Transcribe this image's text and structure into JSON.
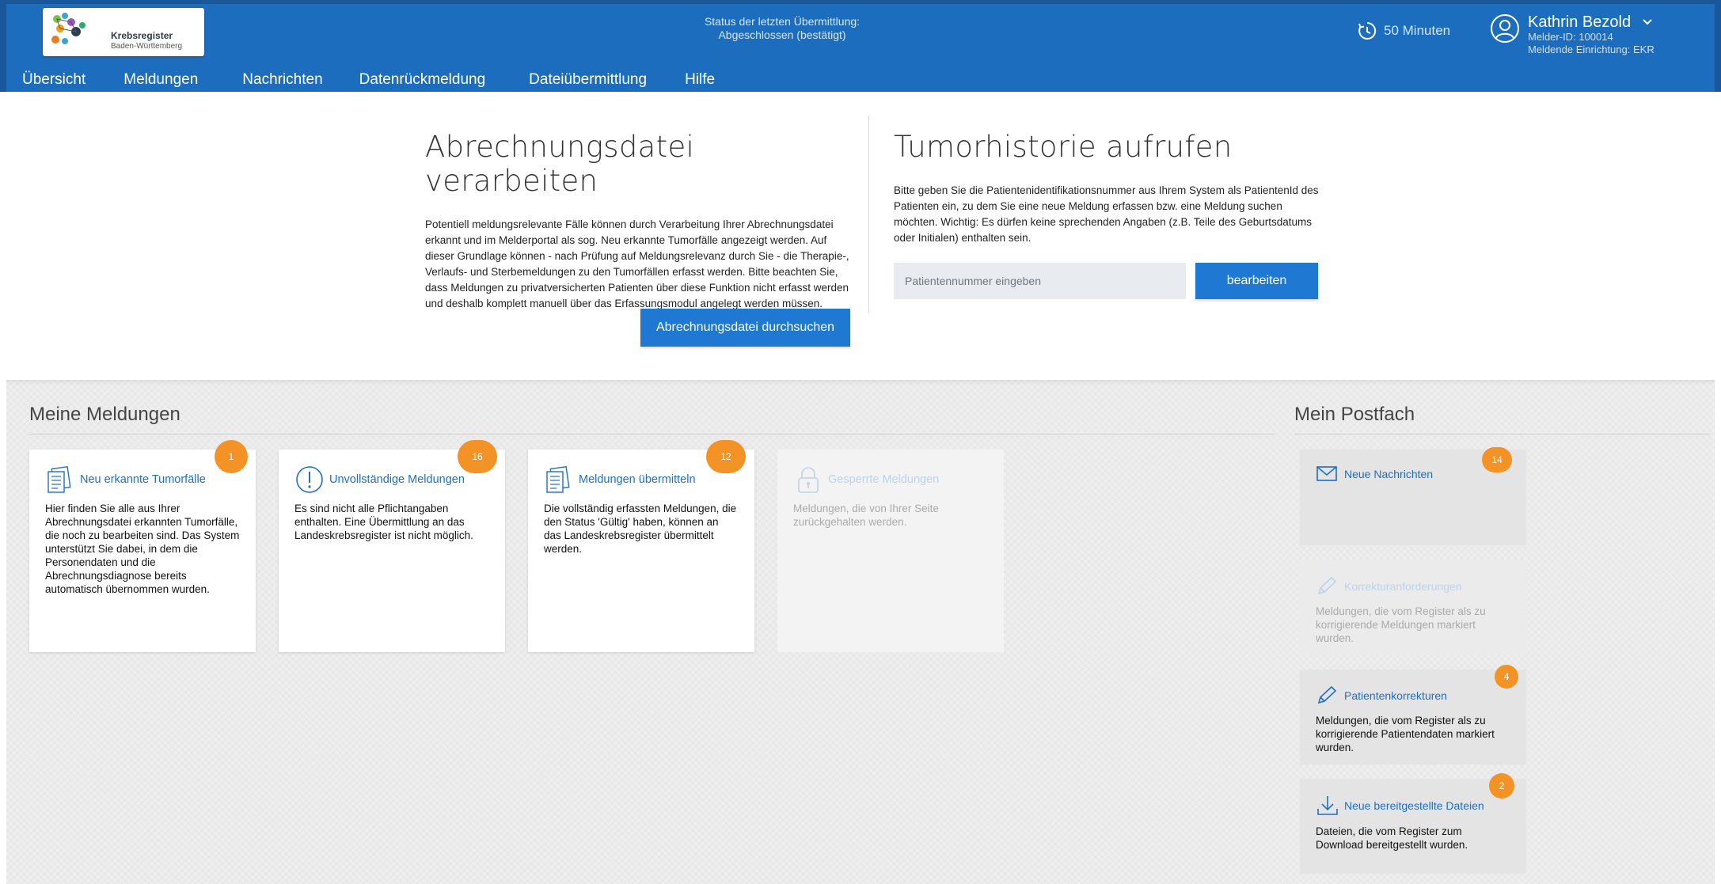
{
  "header": {
    "logo_title": "Krebsregister",
    "logo_subtitle": "Baden-Württemberg",
    "status_line1": "Status der letzten Übermittlung:",
    "status_line2": "Abgeschlossen (bestätigt)",
    "timer": "50 Minuten",
    "user_name": "Kathrin Bezold",
    "melder_id": "Melder-ID: 100014",
    "einrichtung": "Meldende Einrichtung: EKR",
    "accent_color": "#1d6dbf"
  },
  "nav": [
    {
      "label": "Übersicht"
    },
    {
      "label": "Meldungen"
    },
    {
      "label": "Nachrichten"
    },
    {
      "label": "Datenrückmeldung"
    },
    {
      "label": "Dateiübermittlung"
    },
    {
      "label": "Hilfe"
    }
  ],
  "hero": {
    "left": {
      "title": "Abrechnungsdatei verarbeiten",
      "text": "Potentiell meldungsrelevante Fälle können durch Verarbeitung Ihrer Abrechnungsdatei erkannt und im Melderportal als sog. Neu erkannte Tumorfälle angezeigt werden. Auf dieser Grundlage können - nach Prüfung auf Meldungsrelevanz durch Sie - die Therapie-, Verlaufs- und Sterbemeldungen zu den Tumorfällen erfasst werden. Bitte beachten Sie, dass Meldungen zu privatversicherten Patienten über diese Funktion nicht erfasst werden und deshalb komplett manuell über das Erfassungsmodul angelegt werden müssen.",
      "button": "Abrechnungsdatei durchsuchen"
    },
    "right": {
      "title": "Tumorhistorie aufrufen",
      "text": "Bitte geben Sie die Patientenidentifikationsnummer aus Ihrem System als PatientenId des Patienten ein, zu dem Sie eine neue Meldung erfassen bzw. eine Meldung suchen möchten. Wichtig: Es dürfen keine sprechenden Angaben (z.B. Teile des Geburtsdatums oder Initialen) enthalten sein.",
      "placeholder": "Patientennummer eingeben",
      "button": "bearbeiten"
    }
  },
  "meldungen": {
    "title": "Meine Meldungen",
    "cards": [
      {
        "icon": "document-icon",
        "title": "Neu erkannte Tumorfälle",
        "badge": "1",
        "text": "Hier finden Sie alle aus Ihrer Abrechnungsdatei erkannten Tumorfälle, die noch zu bearbeiten sind. Das System unterstützt Sie dabei, in dem die Personendaten und die Abrechnungsdiagnose bereits automatisch übernommen wurden."
      },
      {
        "icon": "exclamation-icon",
        "title": "Unvollständige Meldungen",
        "badge": "16",
        "text": "Es sind nicht alle Pflichtangaben enthalten. Eine Übermittlung an das Landeskrebsregister ist nicht möglich."
      },
      {
        "icon": "document-icon",
        "title": "Meldungen übermitteln",
        "badge": "12",
        "text": "Die vollständig erfassten Meldungen, die den Status 'Gültig' haben, können an das Landeskrebsregister übermittelt werden."
      },
      {
        "icon": "lock-icon",
        "title": "Gesperrte Meldungen",
        "badge": "",
        "text": "Meldungen, die von Ihrer Seite zurückgehalten werden."
      }
    ]
  },
  "postfach": {
    "title": "Mein Postfach",
    "cards": [
      {
        "icon": "envelope-icon",
        "title": "Neue Nachrichten",
        "badge": "14",
        "text": ""
      },
      {
        "icon": "pencil-icon",
        "title": "Korrekturanforderungen",
        "badge": "",
        "text": "Meldungen, die vom Register als zu korrigierende Meldungen markiert wurden."
      },
      {
        "icon": "pencil-icon",
        "title": "Patientenkorrekturen",
        "badge": "4",
        "text": "Meldungen, die vom Register als zu korrigierende Patientendaten markiert wurden."
      },
      {
        "icon": "download-icon",
        "title": "Neue bereitgestellte Dateien",
        "badge": "2",
        "text": "Dateien, die vom Register zum Download bereitgestellt wurden."
      }
    ]
  }
}
